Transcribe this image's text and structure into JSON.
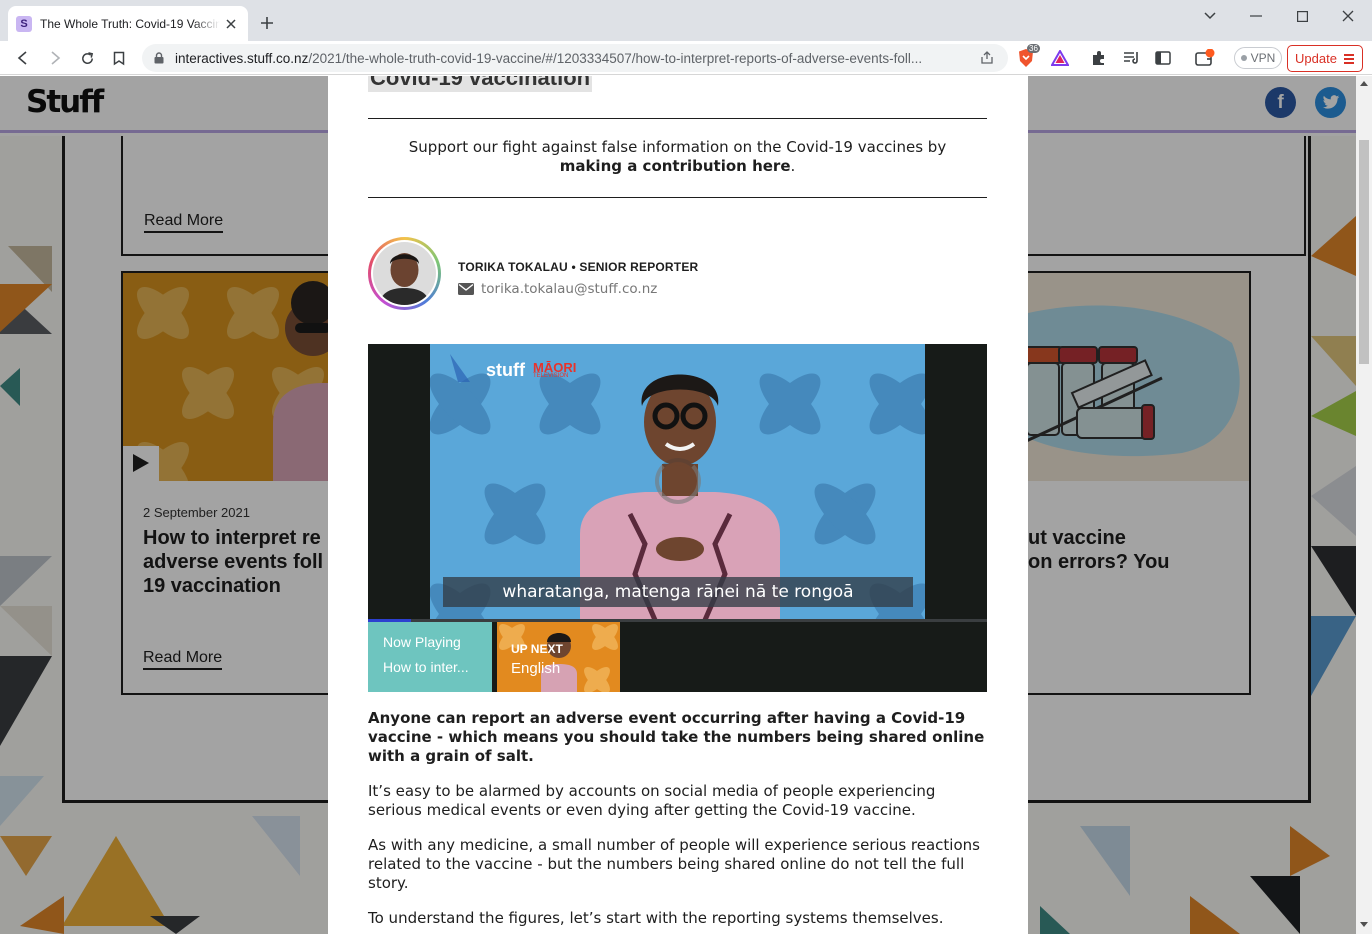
{
  "browser": {
    "tab_title": "The Whole Truth: Covid-19 Vaccine",
    "tab_favicon_letter": "S",
    "url_host": "interactives.stuff.co.nz",
    "url_path": "/2021/the-whole-truth-covid-19-vaccine/#/1203334507/how-to-interpret-reports-of-adverse-events-foll...",
    "brave_badge": "36",
    "vpn_label": "VPN",
    "update_label": "Update"
  },
  "site": {
    "logo": "Stuff",
    "facebook_icon": "f",
    "twitter_icon": "t"
  },
  "cards": [
    {
      "read_more": "Read More"
    },
    {
      "date": "2 September 2021",
      "title_line1": "How to interpret re",
      "title_line2": "adverse events foll",
      "title_line3": "19 vaccination",
      "read_more": "Read More"
    },
    {
      "title_line1": "ut vaccine",
      "title_line2": "on errors? You"
    }
  ],
  "modal": {
    "heading_fragment": "Covid-19 vaccination",
    "support_text": "Support our fight against false information on the Covid-19 vaccines by",
    "support_link": "making a contribution here",
    "support_end": ".",
    "author_line": "TORIKA TOKALAU • SENIOR REPORTER",
    "author_email": "torika.tokalau@stuff.co.nz",
    "video": {
      "brand_stuff": "stuff",
      "brand_maori": "MĀORI",
      "brand_tv": "TELEVISION",
      "subtitle": "wharatanga, matenga rānei nā te rongoā",
      "now_playing_label": "Now Playing",
      "now_playing_title": "How to inter...",
      "up_next_label": "UP NEXT",
      "up_next_title": "English",
      "progress": 0.07
    },
    "lead": "Anyone can report an adverse event occurring after having a Covid-19 vaccine - which means you should take the numbers being shared online with a grain of salt.",
    "paragraphs": [
      "It’s easy to be alarmed by accounts on social media of people experiencing serious medical events or even dying after getting the Covid-19 vaccine.",
      "As with any medicine, a small number of people will experience serious reactions related to the vaccine - but the numbers being shared online do not tell the full story.",
      "To understand the figures, let’s start with the reporting systems themselves."
    ]
  },
  "colors": {
    "accent_purple": "#b9a6e4",
    "facebook": "#2c5aa5",
    "twitter": "#2d8fe0",
    "update_red": "#d93025",
    "now_playing_bg": "#6ec5bf",
    "up_next_bg": "#e28a1f",
    "video_bg": "#5aa7d9"
  }
}
